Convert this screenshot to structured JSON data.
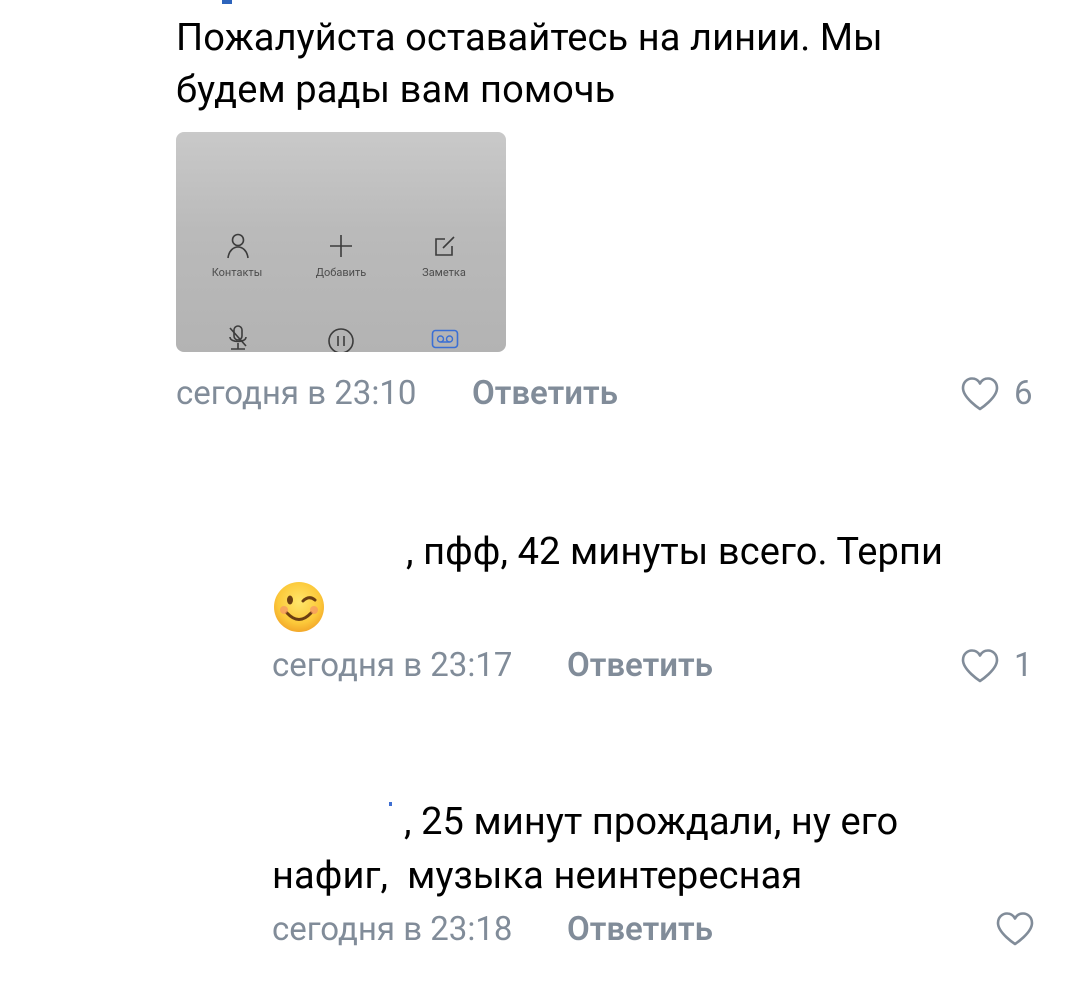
{
  "comments": [
    {
      "text_line1": "Пожалуйста оставайтесь на линии. Мы",
      "text_line2": "будем рады вам помочь",
      "time": "сегодня в 23:10",
      "reply": "Ответить",
      "likes": "6",
      "attachment": {
        "buttons": [
          {
            "icon": "person-icon",
            "label": "Контакты"
          },
          {
            "icon": "plus-icon",
            "label": "Добавить"
          },
          {
            "icon": "note-icon",
            "label": "Заметка"
          }
        ],
        "bottom_icons": [
          "mic-off-icon",
          "pause-icon",
          "voicemail-icon"
        ]
      }
    },
    {
      "text": ", пфф, 42 минуты всего. Терпи",
      "time": "сегодня в 23:17",
      "reply": "Ответить",
      "likes": "1"
    },
    {
      "text_line1": ", 25 минут прождали, ну его",
      "text_line2": "нафиг,  музыка неинтересная",
      "time": "сегодня в 23:18",
      "reply": "Ответить",
      "likes": ""
    }
  ],
  "colors": {
    "meta": "#818c99",
    "text": "#000000",
    "accent": "#3f6fd1"
  }
}
